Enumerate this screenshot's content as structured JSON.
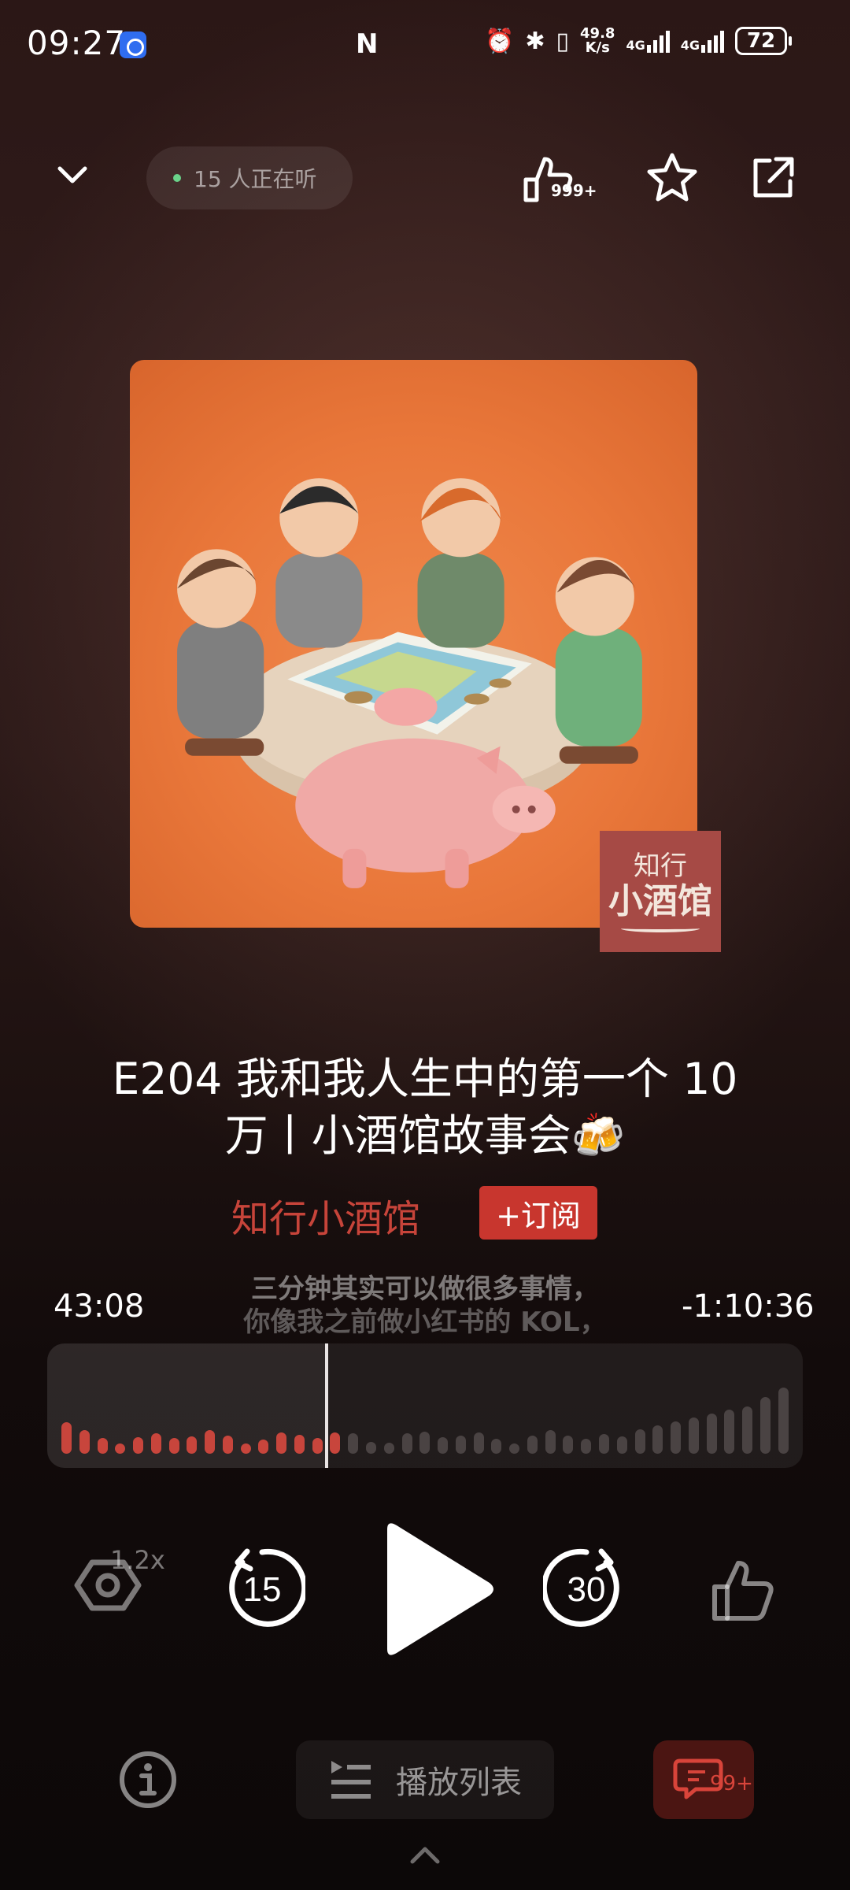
{
  "status_bar": {
    "time": "09:27",
    "net_speed_value": "49.8",
    "net_speed_unit": "K/s",
    "network1": "4G",
    "network2": "4G",
    "battery": "72"
  },
  "header": {
    "listeners": "15 人正在听",
    "recommend_count": "999+"
  },
  "cover": {
    "logo_top": "知行",
    "logo_main": "小酒馆"
  },
  "episode": {
    "title": "E204 我和我人生中的第一个 10 万丨小酒馆故事会🍻",
    "podcast": "知行小酒馆",
    "subscribe": "+订阅"
  },
  "player": {
    "elapsed": "43:08",
    "remaining": "-1:10:36",
    "lyric_line1": "三分钟其实可以做很多事情，",
    "lyric_line2": "你像我之前做小红书的 KOL，",
    "progress": 0.37,
    "speed": "1.2x",
    "back_seconds": "15",
    "forward_seconds": "30"
  },
  "bottom": {
    "playlist": "播放列表",
    "comments": "99+"
  },
  "colors": {
    "accent": "#c8453c",
    "subscribe_bg": "#c8362e",
    "cover_bg": "#e9773a"
  }
}
